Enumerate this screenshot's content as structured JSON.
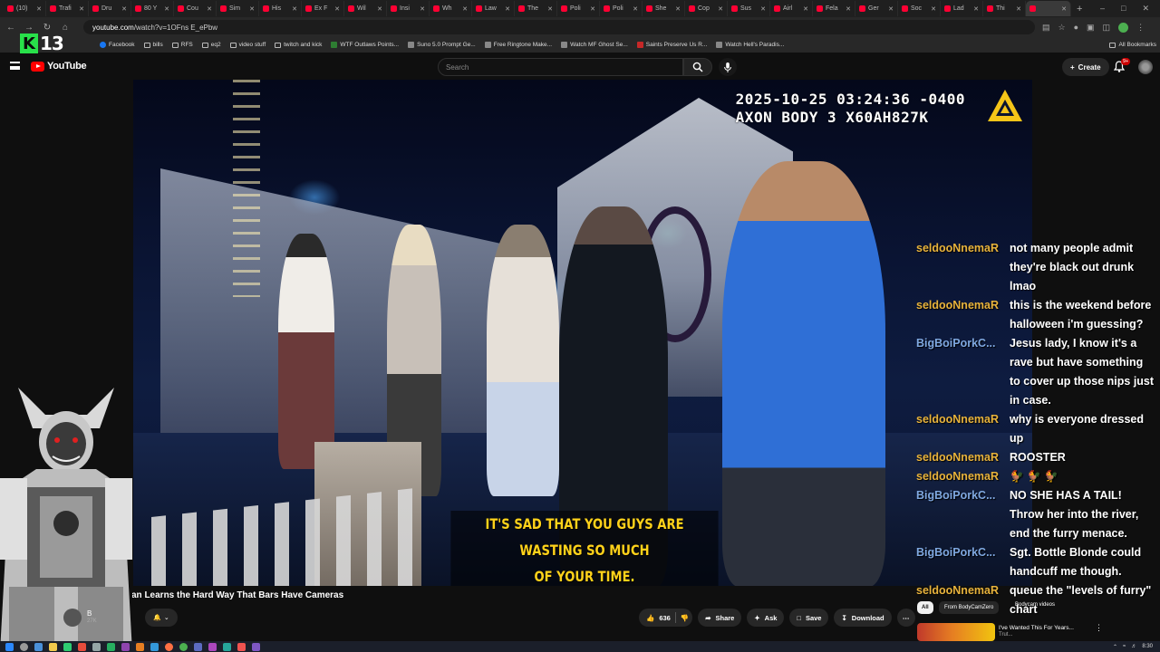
{
  "browser": {
    "tabs": [
      "(10)",
      "Trafi",
      "Dru",
      "80 Y",
      "Cou",
      "Sim",
      "His",
      "Ex F",
      "Wil",
      "Insi",
      "Wh",
      "Law",
      "The",
      "Poli",
      "Poli",
      "She",
      "Cop",
      "Sus",
      "Airl",
      "Fela",
      "Ger",
      "Soc",
      "Lad",
      "Thi",
      ""
    ],
    "new_tab": "+",
    "url_domain": "youtube.com",
    "url_path": "/watch?v=1OFns E_ePbw",
    "bookmarks": [
      {
        "label": "Facebook",
        "icon": "facebook-icon"
      },
      {
        "label": "bills",
        "icon": "folder-icon"
      },
      {
        "label": "RFS",
        "icon": "folder-icon"
      },
      {
        "label": "eq2",
        "icon": "folder-icon"
      },
      {
        "label": "video stuff",
        "icon": "folder-icon"
      },
      {
        "label": "twitch and kick",
        "icon": "folder-icon"
      },
      {
        "label": "WTF Outlaws Points...",
        "icon": "green-icon"
      },
      {
        "label": "Suno 5.0 Prompt Ge...",
        "icon": "generic-icon"
      },
      {
        "label": "Free Ringtone Make...",
        "icon": "generic-icon"
      },
      {
        "label": "Watch MF Ghost Se...",
        "icon": "generic-icon"
      },
      {
        "label": "Saints Preserve Us R...",
        "icon": "red-icon"
      },
      {
        "label": "Watch Hell's Paradis...",
        "icon": "generic-icon"
      }
    ],
    "all_bookmarks": "All Bookmarks"
  },
  "overlay_k13": {
    "letter": "K",
    "number": "13"
  },
  "youtube": {
    "logo_text": "YouTube",
    "search_placeholder": "Search",
    "create_label": "Create",
    "notification_count": "9+"
  },
  "video": {
    "timestamp_line1": "2025-10-25 03:24:36 -0400",
    "timestamp_line2": "AXON BODY 3 X60AH827K",
    "caption_line1": "IT'S SAD THAT YOU GUYS ARE WASTING SO MUCH",
    "caption_line2": "OF YOUR TIME."
  },
  "chat": [
    {
      "user": "seldooNnemaR",
      "color": "#e8b33c",
      "text": "not many people admit they're black out drunk lmao"
    },
    {
      "user": "seldooNnemaR",
      "color": "#e8b33c",
      "text": "this is the weekend before halloween i'm guessing?"
    },
    {
      "user": "BigBoiPorkC...",
      "color": "#7fa8e0",
      "text": "Jesus lady, I know it's a rave but have something to cover up those nips just in case."
    },
    {
      "user": "seldooNnemaR",
      "color": "#e8b33c",
      "text": "why is everyone dressed up"
    },
    {
      "user": "seldooNnemaR",
      "color": "#e8b33c",
      "text": "ROOSTER"
    },
    {
      "user": "seldooNnemaR",
      "color": "#e8b33c",
      "text": "🐓 🐓 🐓"
    },
    {
      "user": "BigBoiPorkC...",
      "color": "#7fa8e0",
      "text": "NO SHE HAS A TAIL! Throw her into the river, end the furry menace."
    },
    {
      "user": "BigBoiPorkC...",
      "color": "#7fa8e0",
      "text": "Sgt. Bottle Blonde could handcuff me though."
    },
    {
      "user": "seldooNnemaR",
      "color": "#e8b33c",
      "text": "queue the \"levels of furry\" chart"
    }
  ],
  "below_video": {
    "title": "oman Learns the Hard Way That Bars Have Cameras",
    "channel_initial": "B",
    "subs": "27K",
    "like_count": "636",
    "share": "Share",
    "ask": "Ask",
    "save": "Save",
    "download": "Download"
  },
  "recommendations": {
    "chip_all": "All",
    "chip_from": "From BodyCamZero",
    "label": "Bodycam videos",
    "title": "I've Wanted This For Years...",
    "channel": "Trut..."
  },
  "taskbar": {
    "time": "8:30"
  }
}
